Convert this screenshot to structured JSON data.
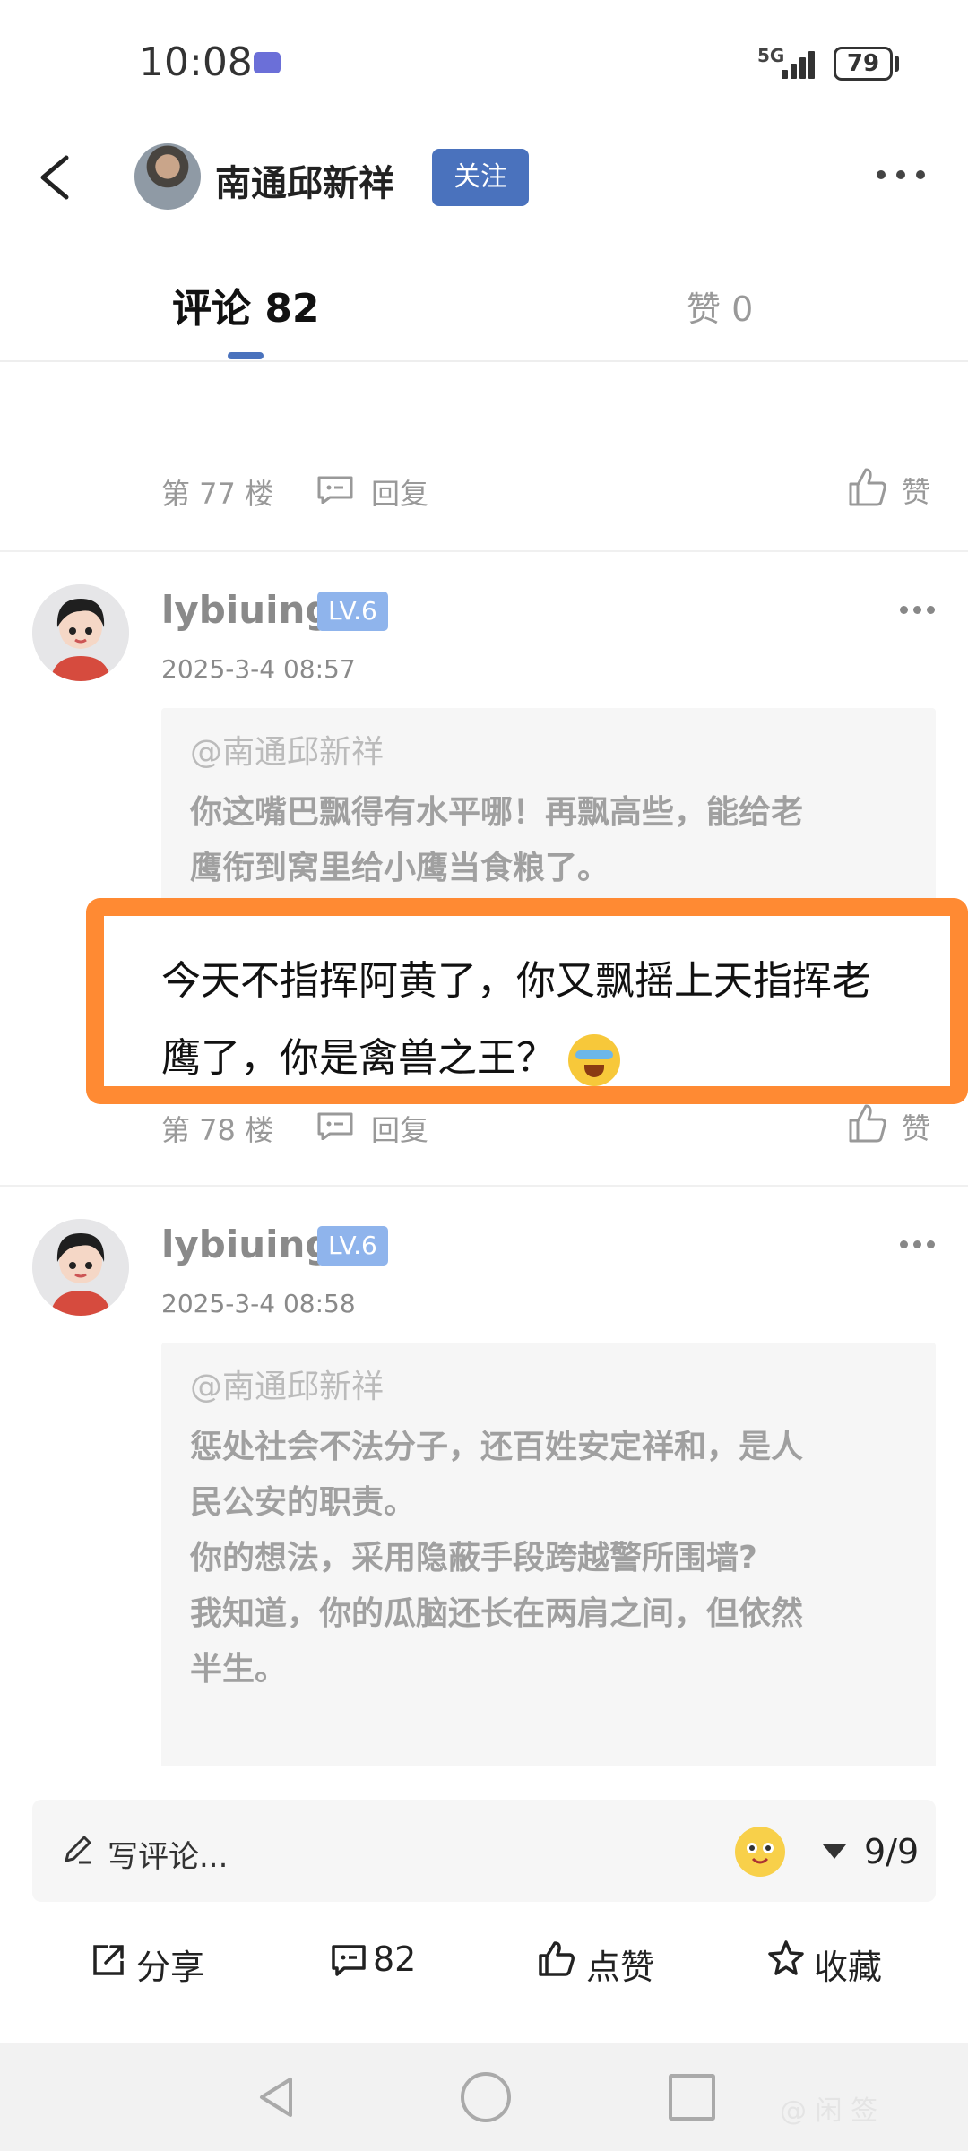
{
  "status_bar": {
    "time": "10:08",
    "network": "5G",
    "battery": "79"
  },
  "header": {
    "author_name": "南通邱新祥",
    "follow_label": "关注"
  },
  "tabs": {
    "comments_label": "评论 82",
    "likes_label": "赞 0"
  },
  "floors": [
    {
      "floor": "第 77 楼",
      "reply": "回复",
      "like": "赞"
    },
    {
      "floor": "第 78 楼",
      "reply": "回复",
      "like": "赞"
    }
  ],
  "comments": [
    {
      "username": "lybiuing",
      "level": "LV.6",
      "time": "2025-3-4 08:57",
      "quote_at": "@南通邱新祥",
      "quote_lines": [
        "你这嘴巴飘得有水平哪！再飘高些，能给老",
        "鹰衔到窝里给小鹰当食粮了。"
      ],
      "body_lines": [
        "今天不指挥阿黄了，你又飘摇上天指挥老",
        "鹰了，你是禽兽之王？"
      ]
    },
    {
      "username": "lybiuing",
      "level": "LV.6",
      "time": "2025-3-4 08:58",
      "quote_at": "@南通邱新祥",
      "quote_lines": [
        "惩处社会不法分子，还百姓安定祥和，是人",
        "民公安的职责。",
        "你的想法，采用隐蔽手段跨越警所围墙?",
        "我知道，你的瓜脑还长在两肩之间，但依然",
        "半生。"
      ]
    }
  ],
  "bottom_bar": {
    "input_placeholder": "写评论...",
    "page_indicator": "9/9",
    "share_label": "分享",
    "comment_count": "82",
    "like_label": "点赞",
    "collect_label": "收藏"
  },
  "watermark": "@ 闲 签",
  "colors": {
    "accent": "#4a72bd",
    "highlight": "#ff8a33",
    "level_badge": "#8fb4ec"
  }
}
